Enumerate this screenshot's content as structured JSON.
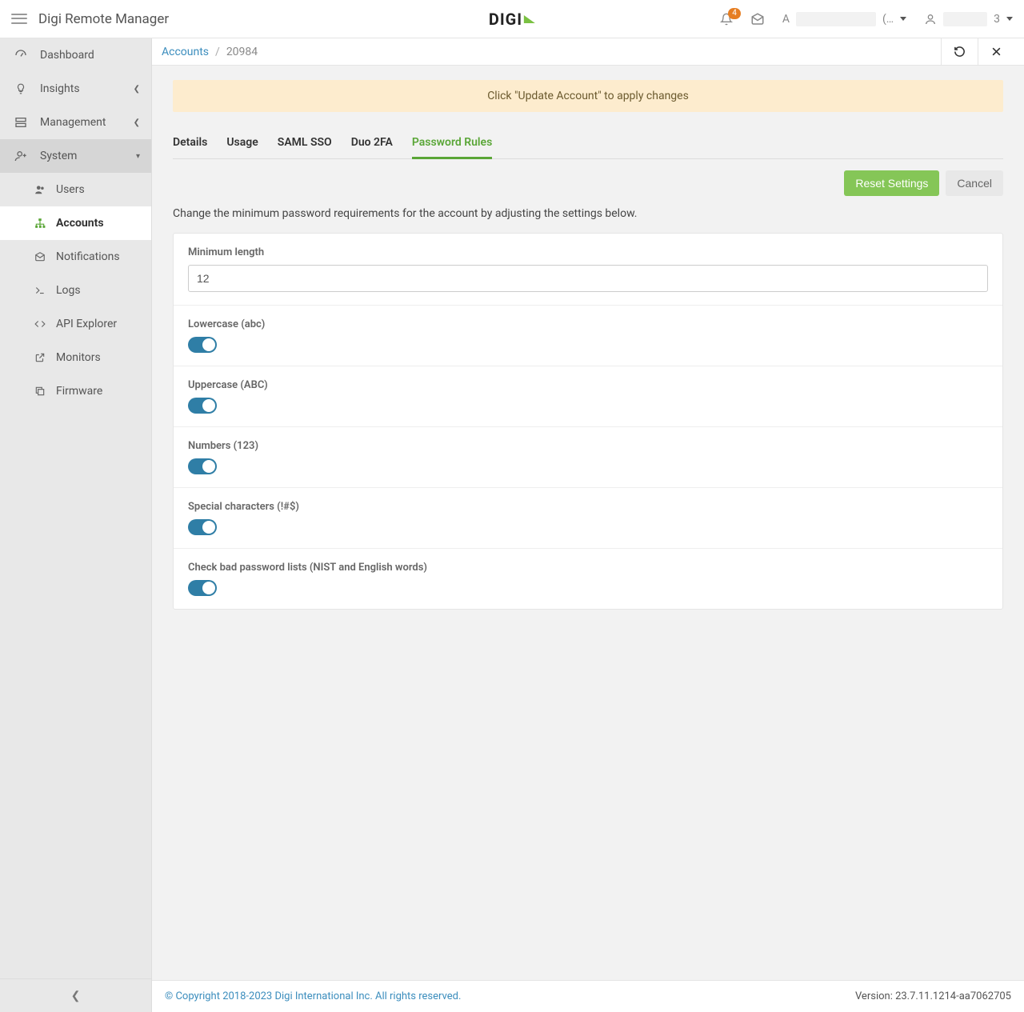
{
  "header": {
    "app_title": "Digi Remote Manager",
    "logo_text": "DIGI",
    "bell_badge": "4",
    "account_prefix": "A",
    "account_suffix": "(…",
    "user_suffix": "3"
  },
  "sidebar": {
    "items": [
      {
        "label": "Dashboard"
      },
      {
        "label": "Insights"
      },
      {
        "label": "Management"
      },
      {
        "label": "System"
      }
    ],
    "subitems": [
      {
        "label": "Users"
      },
      {
        "label": "Accounts"
      },
      {
        "label": "Notifications"
      },
      {
        "label": "Logs"
      },
      {
        "label": "API Explorer"
      },
      {
        "label": "Monitors"
      },
      {
        "label": "Firmware"
      }
    ]
  },
  "breadcrumb": {
    "root": "Accounts",
    "sep": "/",
    "current": "20984"
  },
  "alert": "Click \"Update Account\" to apply changes",
  "tabs": [
    {
      "label": "Details"
    },
    {
      "label": "Usage"
    },
    {
      "label": "SAML SSO"
    },
    {
      "label": "Duo 2FA"
    },
    {
      "label": "Password Rules"
    }
  ],
  "actions": {
    "reset": "Reset Settings",
    "cancel": "Cancel"
  },
  "helper_text": "Change the minimum password requirements for the account by adjusting the settings below.",
  "form": {
    "min_length_label": "Minimum length",
    "min_length_value": "12",
    "lowercase_label": "Lowercase (abc)",
    "lowercase_on": true,
    "uppercase_label": "Uppercase (ABC)",
    "uppercase_on": true,
    "numbers_label": "Numbers (123)",
    "numbers_on": true,
    "special_label": "Special characters (!#$)",
    "special_on": true,
    "badlist_label": "Check bad password lists (NIST and English words)",
    "badlist_on": true
  },
  "footer": {
    "copyright": "© Copyright 2018-2023 Digi International Inc. All rights reserved.",
    "version": "Version: 23.7.11.1214-aa7062705"
  }
}
